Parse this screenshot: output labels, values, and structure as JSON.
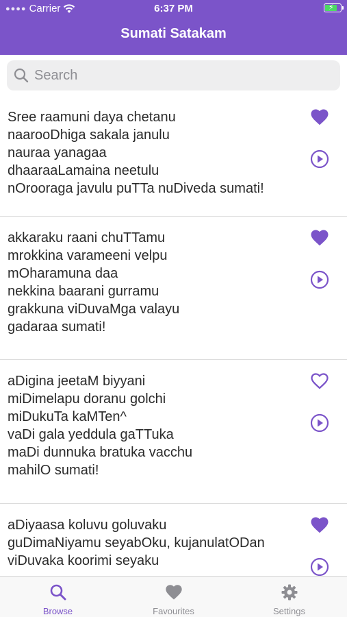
{
  "status_bar": {
    "carrier": "Carrier",
    "time": "6:37 PM"
  },
  "nav": {
    "title": "Sumati Satakam"
  },
  "search": {
    "placeholder": "Search"
  },
  "colors": {
    "accent": "#7b54c9",
    "tab_inactive": "#8e8e93"
  },
  "verses": [
    {
      "text": "Sree raamuni daya chetanu\nnaarooDhiga sakala janulu\nnauraa yanagaa\ndhaaraaLamaina neetulu\nnOrooraga javulu puTTa nuDiveda sumati!",
      "favourite": true
    },
    {
      "text": "akkaraku raani chuTTamu\nmrokkina varameeni velpu\nmOharamuna daa\nnekkina baarani gurramu\ngrakkuna viDuvaMga valayu\ngadaraa sumati!",
      "favourite": true
    },
    {
      "text": "aDigina jeetaM biyyani\nmiDimelapu doranu golchi\nmiDukuTa kaMTen^\nvaDi gala yeddula gaTTuka\nmaDi dunnuka bratuka vacchu\nmahilO sumati!",
      "favourite": false
    },
    {
      "text": "aDiyaasa koluvu goluvaku\nguDimaNiyamu seyabOku, kujanulatODan\nviDuvaka koorimi seyaku",
      "favourite": true
    }
  ],
  "tabs": [
    {
      "label": "Browse",
      "icon": "search-icon",
      "active": true
    },
    {
      "label": "Favourites",
      "icon": "heart-icon",
      "active": false
    },
    {
      "label": "Settings",
      "icon": "gear-icon",
      "active": false
    }
  ]
}
